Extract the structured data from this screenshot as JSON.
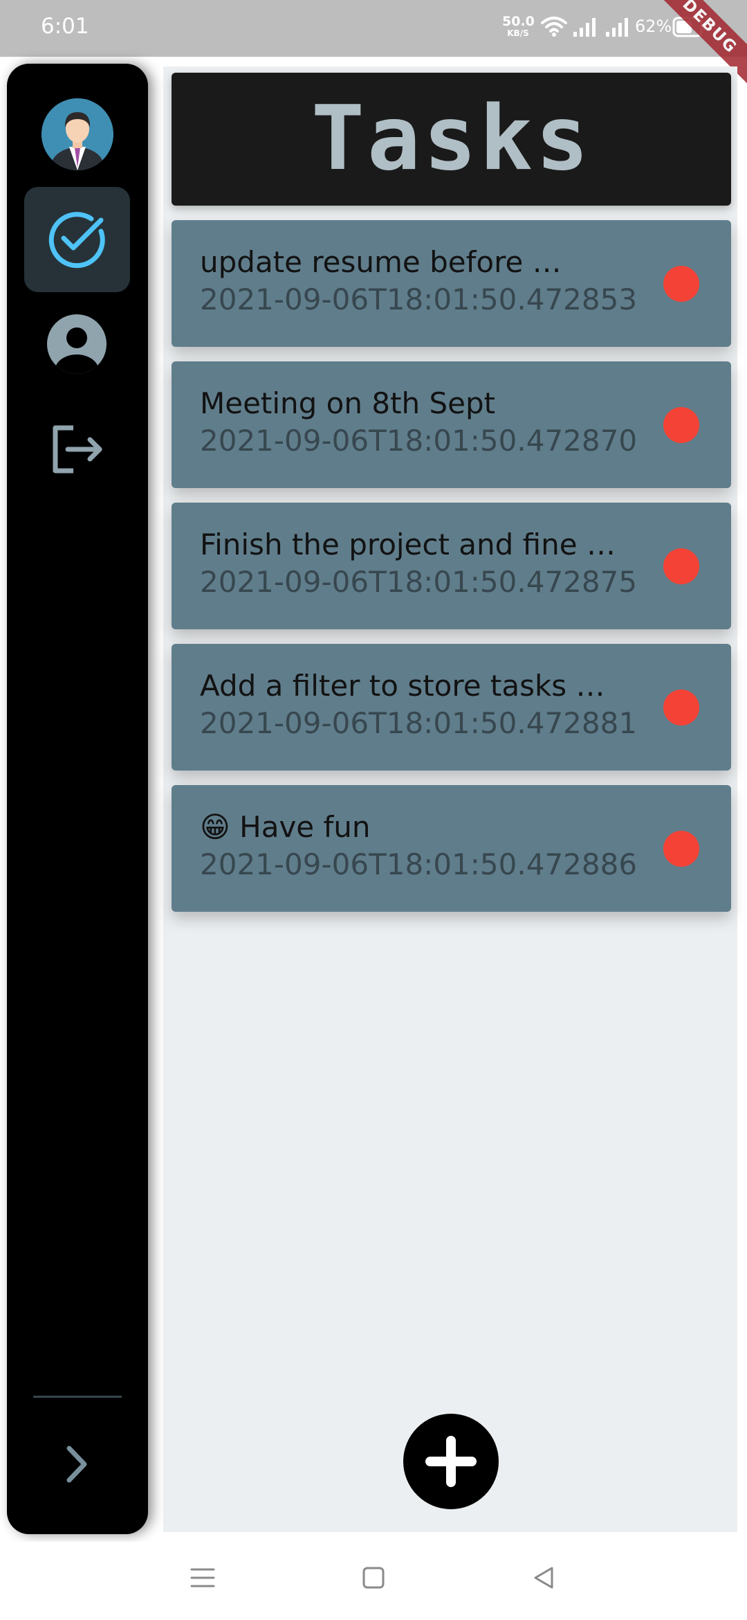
{
  "status_bar": {
    "time": "6:01",
    "net_speed_value": "50.0",
    "net_speed_unit": "KB/S",
    "battery_percent": "62%",
    "debug_banner": "DEBUG"
  },
  "sidebar": {
    "avatar": "avatar",
    "items": [
      {
        "icon": "check-circle-icon",
        "active": true
      },
      {
        "icon": "account-circle-icon",
        "active": false
      },
      {
        "icon": "logout-icon",
        "active": false
      }
    ],
    "expand_icon": "chevron-right-icon"
  },
  "header": {
    "title": "Tasks"
  },
  "tasks": [
    {
      "title": "update resume before …",
      "date": "2021-09-06T18:01:50.472853"
    },
    {
      "title": "Meeting on 8th Sept",
      "date": "2021-09-06T18:01:50.472870"
    },
    {
      "title": "Finish the project and fine …",
      "date": "2021-09-06T18:01:50.472875"
    },
    {
      "title": "Add a filter to store tasks an…",
      "date": "2021-09-06T18:01:50.472881"
    },
    {
      "title": "😁 Have fun",
      "date": "2021-09-06T18:01:50.472886"
    }
  ],
  "fab": {
    "icon": "add-icon"
  },
  "colors": {
    "accent": "#4fc3f7",
    "card": "#607d8b",
    "status_dot": "#f44336",
    "header_text": "#b0bec5"
  }
}
